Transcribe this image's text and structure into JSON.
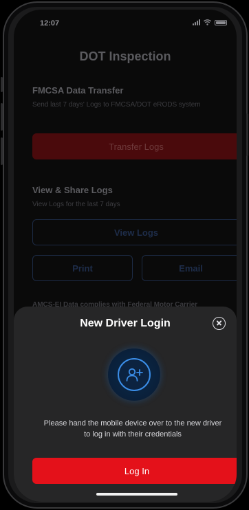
{
  "status_bar": {
    "time": "12:07"
  },
  "background": {
    "title": "DOT Inspection",
    "fmcsa": {
      "title": "FMCSA Data Transfer",
      "description": "Send last 7 days' Logs to FMCSA/DOT eRODS system",
      "button_label": "Transfer Logs"
    },
    "view_share": {
      "title": "View & Share Logs",
      "description": "View Logs for the last 7 days",
      "view_button_label": "View Logs",
      "print_button_label": "Print",
      "email_button_label": "Email"
    },
    "peek_text": "AMCS-EI Data complies with Federal Motor Carrier"
  },
  "sheet": {
    "title": "New Driver Login",
    "icon": "add-user-icon",
    "message": "Please hand the mobile device over to the new driver to log in with their credentials",
    "login_label": "Log In"
  },
  "colors": {
    "accent_red": "#e4111a",
    "accent_blue": "#3b8ee8",
    "sheet_bg": "#262627"
  }
}
